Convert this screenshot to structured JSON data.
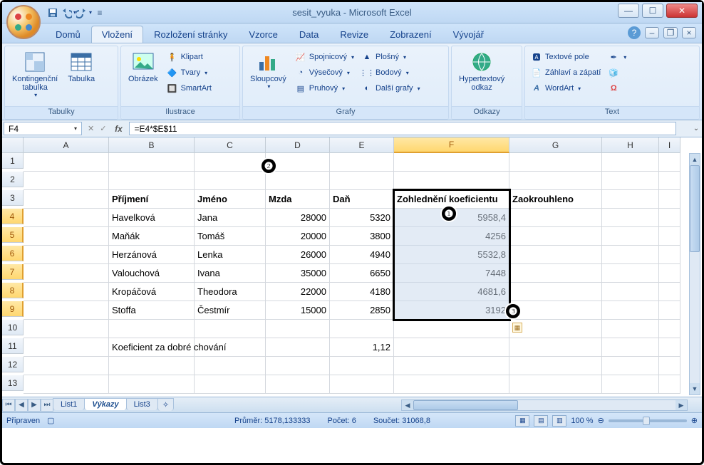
{
  "title": "sesit_vyuka - Microsoft Excel",
  "tabs": [
    "Domů",
    "Vložení",
    "Rozložení stránky",
    "Vzorce",
    "Data",
    "Revize",
    "Zobrazení",
    "Vývojář"
  ],
  "active_tab": 1,
  "ribbon": {
    "tabulky": {
      "label": "Tabulky",
      "kontingencni": "Kontingenční\ntabulka",
      "tabulka": "Tabulka"
    },
    "ilustrace": {
      "label": "Ilustrace",
      "obrazek": "Obrázek",
      "klipart": "Klipart",
      "tvary": "Tvary",
      "smartart": "SmartArt"
    },
    "grafy": {
      "label": "Grafy",
      "sloupcovy": "Sloupcový",
      "spojnicovy": "Spojnicový",
      "vysecovy": "Výsečový",
      "pruhovy": "Pruhový",
      "plosny": "Plošný",
      "bodovy": "Bodový",
      "dalsi": "Další grafy"
    },
    "odkazy": {
      "label": "Odkazy",
      "hypertext": "Hypertextový\nodkaz"
    },
    "text": {
      "label": "Text",
      "textove_pole": "Textové pole",
      "zahlavi": "Záhlaví a zápatí",
      "wordart": "WordArt"
    }
  },
  "namebox": "F4",
  "formula": "=E4*$E$11",
  "columns": [
    "A",
    "B",
    "C",
    "D",
    "E",
    "F",
    "G",
    "H",
    "I"
  ],
  "selected_col": "F",
  "selected_rows": [
    4,
    5,
    6,
    7,
    8,
    9
  ],
  "rows": [
    1,
    2,
    3,
    4,
    5,
    6,
    7,
    8,
    9,
    10,
    11,
    12,
    13
  ],
  "data": {
    "headers": {
      "B": "Příjmení",
      "C": "Jméno",
      "D": "Mzda",
      "E": "Daň",
      "F": "Zohlednění koeficientu",
      "G": "Zaokrouhleno"
    },
    "body": [
      {
        "B": "Havelková",
        "C": "Jana",
        "D": "28000",
        "E": "5320",
        "F": "5958,4"
      },
      {
        "B": "Maňák",
        "C": "Tomáš",
        "D": "20000",
        "E": "3800",
        "F": "4256"
      },
      {
        "B": "Herzánová",
        "C": "Lenka",
        "D": "26000",
        "E": "4940",
        "F": "5532,8"
      },
      {
        "B": "Valouchová",
        "C": "Ivana",
        "D": "35000",
        "E": "6650",
        "F": "7448"
      },
      {
        "B": "Kropáčová",
        "C": "Theodora",
        "D": "22000",
        "E": "4180",
        "F": "4681,6"
      },
      {
        "B": "Stoffa",
        "C": "Čestmír",
        "D": "15000",
        "E": "2850",
        "F": "3192"
      }
    ],
    "koef_label": "Koeficient za dobré chování",
    "koef_val": "1,12"
  },
  "sheets": [
    "List1",
    "Výkazy",
    "List3"
  ],
  "active_sheet": 1,
  "status": {
    "ready": "Připraven",
    "prumer": "Průměr: 5178,133333",
    "pocet": "Počet: 6",
    "soucet": "Součet: 31068,8",
    "zoom": "100 %"
  },
  "annotations": {
    "1": "❶",
    "2": "❷",
    "3": "❸"
  }
}
